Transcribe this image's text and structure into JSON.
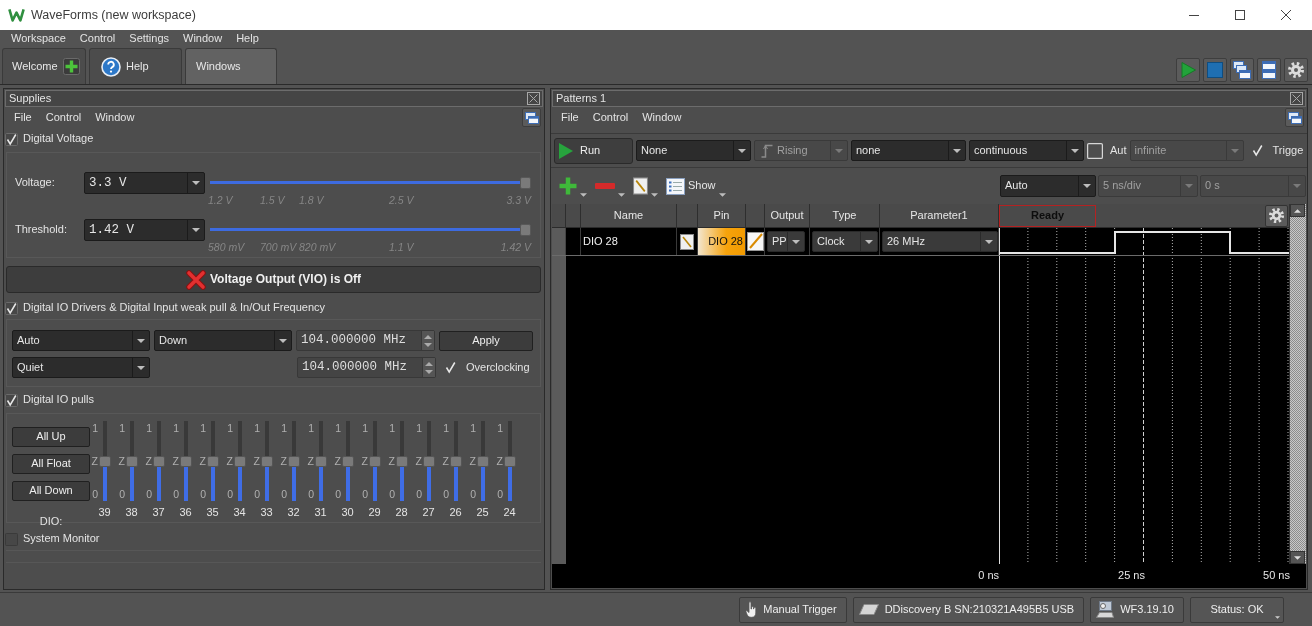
{
  "window": {
    "title": "WaveForms (new workspace)"
  },
  "menu": [
    "Workspace",
    "Control",
    "Settings",
    "Window",
    "Help"
  ],
  "tabs": [
    {
      "label": "Welcome",
      "kind": "add",
      "selected": false
    },
    {
      "label": "Help",
      "kind": "help",
      "selected": false
    },
    {
      "label": "Windows",
      "kind": "plain",
      "selected": true
    }
  ],
  "supplies": {
    "title": "Supplies",
    "menu": [
      "File",
      "Control",
      "Window"
    ],
    "digital_voltage": {
      "label": "Digital Voltage",
      "checked": true,
      "rows": [
        {
          "label": "Voltage:",
          "value": "3.3 V",
          "level": 1,
          "ticks": [
            "1.2 V",
            "1.5 V",
            "1.8 V",
            "2.5 V",
            "3.3 V"
          ]
        },
        {
          "label": "Threshold:",
          "value": "1.42 V",
          "level": 1,
          "ticks": [
            "580 mV",
            "700 mV",
            "820 mV",
            "1.1 V",
            "1.42 V"
          ]
        }
      ]
    },
    "vio": {
      "label": "Voltage Output (VIO) is Off",
      "on": false
    },
    "io_drivers": {
      "label": "Digital IO Drivers & Digital Input weak pull & In/Out Frequency",
      "checked": true,
      "drive": "Auto",
      "pull": "Down",
      "frequency": "104.000000 MHz",
      "apply": "Apply",
      "slew": "Quiet",
      "frequency_2": "104.000000 MHz",
      "overclocking": {
        "label": "Overclocking",
        "checked": true
      }
    },
    "io_pulls": {
      "label": "Digital IO pulls",
      "checked": true,
      "buttons": [
        "All Up",
        "All Float",
        "All Down"
      ],
      "pins_label": "DIO:",
      "pins": [
        {
          "pin": "39",
          "high": "1",
          "float": "Z",
          "low": "0",
          "level": 0.5
        },
        {
          "pin": "38",
          "high": "1",
          "float": "Z",
          "low": "0",
          "level": 0.5
        },
        {
          "pin": "37",
          "high": "1",
          "float": "Z",
          "low": "0",
          "level": 0.5
        },
        {
          "pin": "36",
          "high": "1",
          "float": "Z",
          "low": "0",
          "level": 0.5
        },
        {
          "pin": "35",
          "high": "1",
          "float": "Z",
          "low": "0",
          "level": 0.5
        },
        {
          "pin": "34",
          "high": "1",
          "float": "Z",
          "low": "0",
          "level": 0.5
        },
        {
          "pin": "33",
          "high": "1",
          "float": "Z",
          "low": "0",
          "level": 0.5
        },
        {
          "pin": "32",
          "high": "1",
          "float": "Z",
          "low": "0",
          "level": 0.5
        },
        {
          "pin": "31",
          "high": "1",
          "float": "Z",
          "low": "0",
          "level": 0.5
        },
        {
          "pin": "30",
          "high": "1",
          "float": "Z",
          "low": "0",
          "level": 0.5
        },
        {
          "pin": "29",
          "high": "1",
          "float": "Z",
          "low": "0",
          "level": 0.5
        },
        {
          "pin": "28",
          "high": "1",
          "float": "Z",
          "low": "0",
          "level": 0.5
        },
        {
          "pin": "27",
          "high": "1",
          "float": "Z",
          "low": "0",
          "level": 0.5
        },
        {
          "pin": "26",
          "high": "1",
          "float": "Z",
          "low": "0",
          "level": 0.5
        },
        {
          "pin": "25",
          "high": "1",
          "float": "Z",
          "low": "0",
          "level": 0.5
        },
        {
          "pin": "24",
          "high": "1",
          "float": "Z",
          "low": "0",
          "level": 0.5
        }
      ]
    },
    "system_monitor": {
      "label": "System Monitor",
      "checked": false
    }
  },
  "patterns": {
    "title": "Patterns 1",
    "menu": [
      "File",
      "Control",
      "Window"
    ],
    "run": "Run",
    "trigger": {
      "value": "None",
      "disabled": false
    },
    "edge": {
      "value": "Rising",
      "disabled": true
    },
    "option": {
      "value": "none",
      "disabled": false
    },
    "run_mode": {
      "value": "continuous",
      "disabled": false
    },
    "auto": {
      "label": "Aut",
      "checked": false
    },
    "repeat": {
      "value": "infinite",
      "disabled": true
    },
    "trigger_check": {
      "label": "Trigge",
      "checked": true
    },
    "show": "Show",
    "time_mode": {
      "value": "Auto",
      "disabled": false
    },
    "time_base": {
      "value": "5 ns/div",
      "disabled": true
    },
    "position": {
      "value": "0 s",
      "disabled": true
    },
    "columns": [
      "Name",
      "Pin",
      "Output",
      "Type",
      "Parameter1"
    ],
    "plot_status": "Ready",
    "rows": [
      {
        "name": "DIO 28",
        "pin": "DIO 28",
        "output": "PP",
        "type": "Clock",
        "parameter1": "26 MHz"
      }
    ],
    "time_labels": [
      "0 ns",
      "25 ns",
      "50 ns"
    ]
  },
  "status_bar": {
    "manual_trigger": "Manual Trigger",
    "device": "DDiscovery B SN:210321A495B5 USB",
    "version": "WF3.19.10",
    "status": "Status: OK"
  }
}
